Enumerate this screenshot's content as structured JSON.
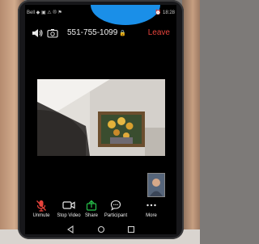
{
  "status_bar": {
    "left": "Bell ◆ ▣ ⚠ ® ⚑",
    "right": "⏰ 18:28"
  },
  "meeting": {
    "id": "551-755-1099",
    "leave_label": "Leave"
  },
  "toolbar": {
    "items": [
      {
        "label": "Unmute"
      },
      {
        "label": "Stop Video"
      },
      {
        "label": "Share"
      },
      {
        "label": "Participant"
      },
      {
        "label": "More"
      }
    ]
  },
  "colors": {
    "leave": "#e8433b",
    "share": "#27c04a",
    "mic_muted": "#e8433b"
  }
}
